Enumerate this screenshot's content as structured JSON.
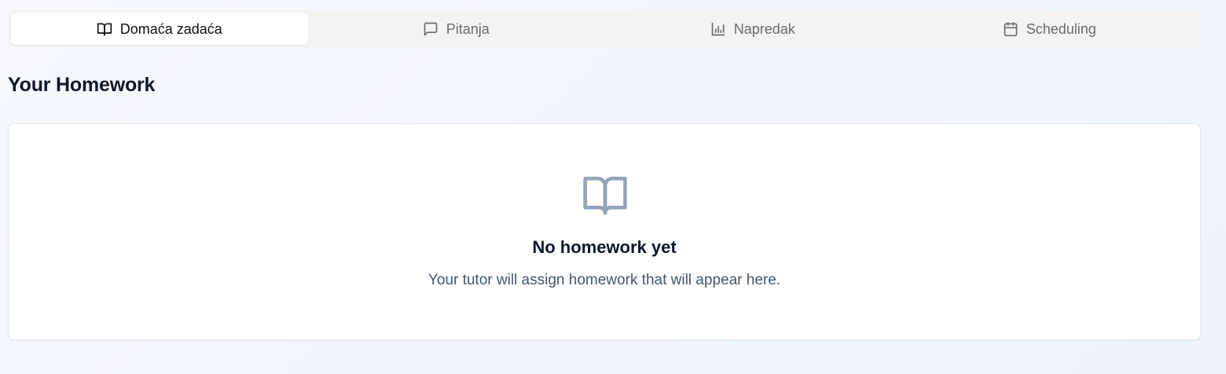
{
  "tabs": [
    {
      "label": "Domaća zadaća",
      "icon": "book-open-icon",
      "active": true
    },
    {
      "label": "Pitanja",
      "icon": "message-square-icon",
      "active": false
    },
    {
      "label": "Napredak",
      "icon": "bar-chart-icon",
      "active": false
    },
    {
      "label": "Scheduling",
      "icon": "calendar-icon",
      "active": false
    }
  ],
  "section": {
    "title": "Your Homework"
  },
  "empty_state": {
    "icon": "book-open-icon",
    "title": "No homework yet",
    "message": "Your tutor will assign homework that will appear here."
  },
  "colors": {
    "page_background": "#f3f6fb",
    "tab_bar": "#f4f3f2",
    "active_tab": "#ffffff",
    "empty_icon": "#94a3b8",
    "heading_text": "#0f172a",
    "muted_text": "#475569"
  }
}
